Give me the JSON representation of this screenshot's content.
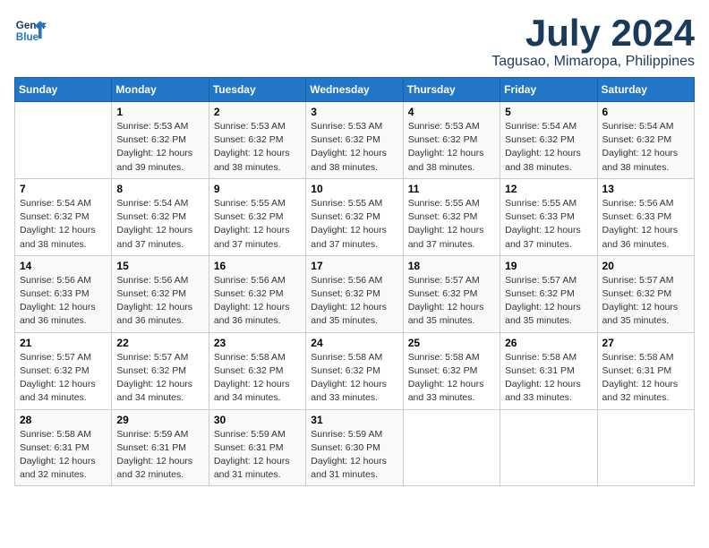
{
  "header": {
    "logo_line1": "General",
    "logo_line2": "Blue",
    "month": "July 2024",
    "location": "Tagusao, Mimaropa, Philippines"
  },
  "days_of_week": [
    "Sunday",
    "Monday",
    "Tuesday",
    "Wednesday",
    "Thursday",
    "Friday",
    "Saturday"
  ],
  "weeks": [
    [
      {
        "day": "",
        "info": ""
      },
      {
        "day": "1",
        "info": "Sunrise: 5:53 AM\nSunset: 6:32 PM\nDaylight: 12 hours\nand 39 minutes."
      },
      {
        "day": "2",
        "info": "Sunrise: 5:53 AM\nSunset: 6:32 PM\nDaylight: 12 hours\nand 38 minutes."
      },
      {
        "day": "3",
        "info": "Sunrise: 5:53 AM\nSunset: 6:32 PM\nDaylight: 12 hours\nand 38 minutes."
      },
      {
        "day": "4",
        "info": "Sunrise: 5:53 AM\nSunset: 6:32 PM\nDaylight: 12 hours\nand 38 minutes."
      },
      {
        "day": "5",
        "info": "Sunrise: 5:54 AM\nSunset: 6:32 PM\nDaylight: 12 hours\nand 38 minutes."
      },
      {
        "day": "6",
        "info": "Sunrise: 5:54 AM\nSunset: 6:32 PM\nDaylight: 12 hours\nand 38 minutes."
      }
    ],
    [
      {
        "day": "7",
        "info": "Sunrise: 5:54 AM\nSunset: 6:32 PM\nDaylight: 12 hours\nand 38 minutes."
      },
      {
        "day": "8",
        "info": "Sunrise: 5:54 AM\nSunset: 6:32 PM\nDaylight: 12 hours\nand 37 minutes."
      },
      {
        "day": "9",
        "info": "Sunrise: 5:55 AM\nSunset: 6:32 PM\nDaylight: 12 hours\nand 37 minutes."
      },
      {
        "day": "10",
        "info": "Sunrise: 5:55 AM\nSunset: 6:32 PM\nDaylight: 12 hours\nand 37 minutes."
      },
      {
        "day": "11",
        "info": "Sunrise: 5:55 AM\nSunset: 6:32 PM\nDaylight: 12 hours\nand 37 minutes."
      },
      {
        "day": "12",
        "info": "Sunrise: 5:55 AM\nSunset: 6:33 PM\nDaylight: 12 hours\nand 37 minutes."
      },
      {
        "day": "13",
        "info": "Sunrise: 5:56 AM\nSunset: 6:33 PM\nDaylight: 12 hours\nand 36 minutes."
      }
    ],
    [
      {
        "day": "14",
        "info": "Sunrise: 5:56 AM\nSunset: 6:33 PM\nDaylight: 12 hours\nand 36 minutes."
      },
      {
        "day": "15",
        "info": "Sunrise: 5:56 AM\nSunset: 6:32 PM\nDaylight: 12 hours\nand 36 minutes."
      },
      {
        "day": "16",
        "info": "Sunrise: 5:56 AM\nSunset: 6:32 PM\nDaylight: 12 hours\nand 36 minutes."
      },
      {
        "day": "17",
        "info": "Sunrise: 5:56 AM\nSunset: 6:32 PM\nDaylight: 12 hours\nand 35 minutes."
      },
      {
        "day": "18",
        "info": "Sunrise: 5:57 AM\nSunset: 6:32 PM\nDaylight: 12 hours\nand 35 minutes."
      },
      {
        "day": "19",
        "info": "Sunrise: 5:57 AM\nSunset: 6:32 PM\nDaylight: 12 hours\nand 35 minutes."
      },
      {
        "day": "20",
        "info": "Sunrise: 5:57 AM\nSunset: 6:32 PM\nDaylight: 12 hours\nand 35 minutes."
      }
    ],
    [
      {
        "day": "21",
        "info": "Sunrise: 5:57 AM\nSunset: 6:32 PM\nDaylight: 12 hours\nand 34 minutes."
      },
      {
        "day": "22",
        "info": "Sunrise: 5:57 AM\nSunset: 6:32 PM\nDaylight: 12 hours\nand 34 minutes."
      },
      {
        "day": "23",
        "info": "Sunrise: 5:58 AM\nSunset: 6:32 PM\nDaylight: 12 hours\nand 34 minutes."
      },
      {
        "day": "24",
        "info": "Sunrise: 5:58 AM\nSunset: 6:32 PM\nDaylight: 12 hours\nand 33 minutes."
      },
      {
        "day": "25",
        "info": "Sunrise: 5:58 AM\nSunset: 6:32 PM\nDaylight: 12 hours\nand 33 minutes."
      },
      {
        "day": "26",
        "info": "Sunrise: 5:58 AM\nSunset: 6:31 PM\nDaylight: 12 hours\nand 33 minutes."
      },
      {
        "day": "27",
        "info": "Sunrise: 5:58 AM\nSunset: 6:31 PM\nDaylight: 12 hours\nand 32 minutes."
      }
    ],
    [
      {
        "day": "28",
        "info": "Sunrise: 5:58 AM\nSunset: 6:31 PM\nDaylight: 12 hours\nand 32 minutes."
      },
      {
        "day": "29",
        "info": "Sunrise: 5:59 AM\nSunset: 6:31 PM\nDaylight: 12 hours\nand 32 minutes."
      },
      {
        "day": "30",
        "info": "Sunrise: 5:59 AM\nSunset: 6:31 PM\nDaylight: 12 hours\nand 31 minutes."
      },
      {
        "day": "31",
        "info": "Sunrise: 5:59 AM\nSunset: 6:30 PM\nDaylight: 12 hours\nand 31 minutes."
      },
      {
        "day": "",
        "info": ""
      },
      {
        "day": "",
        "info": ""
      },
      {
        "day": "",
        "info": ""
      }
    ]
  ]
}
